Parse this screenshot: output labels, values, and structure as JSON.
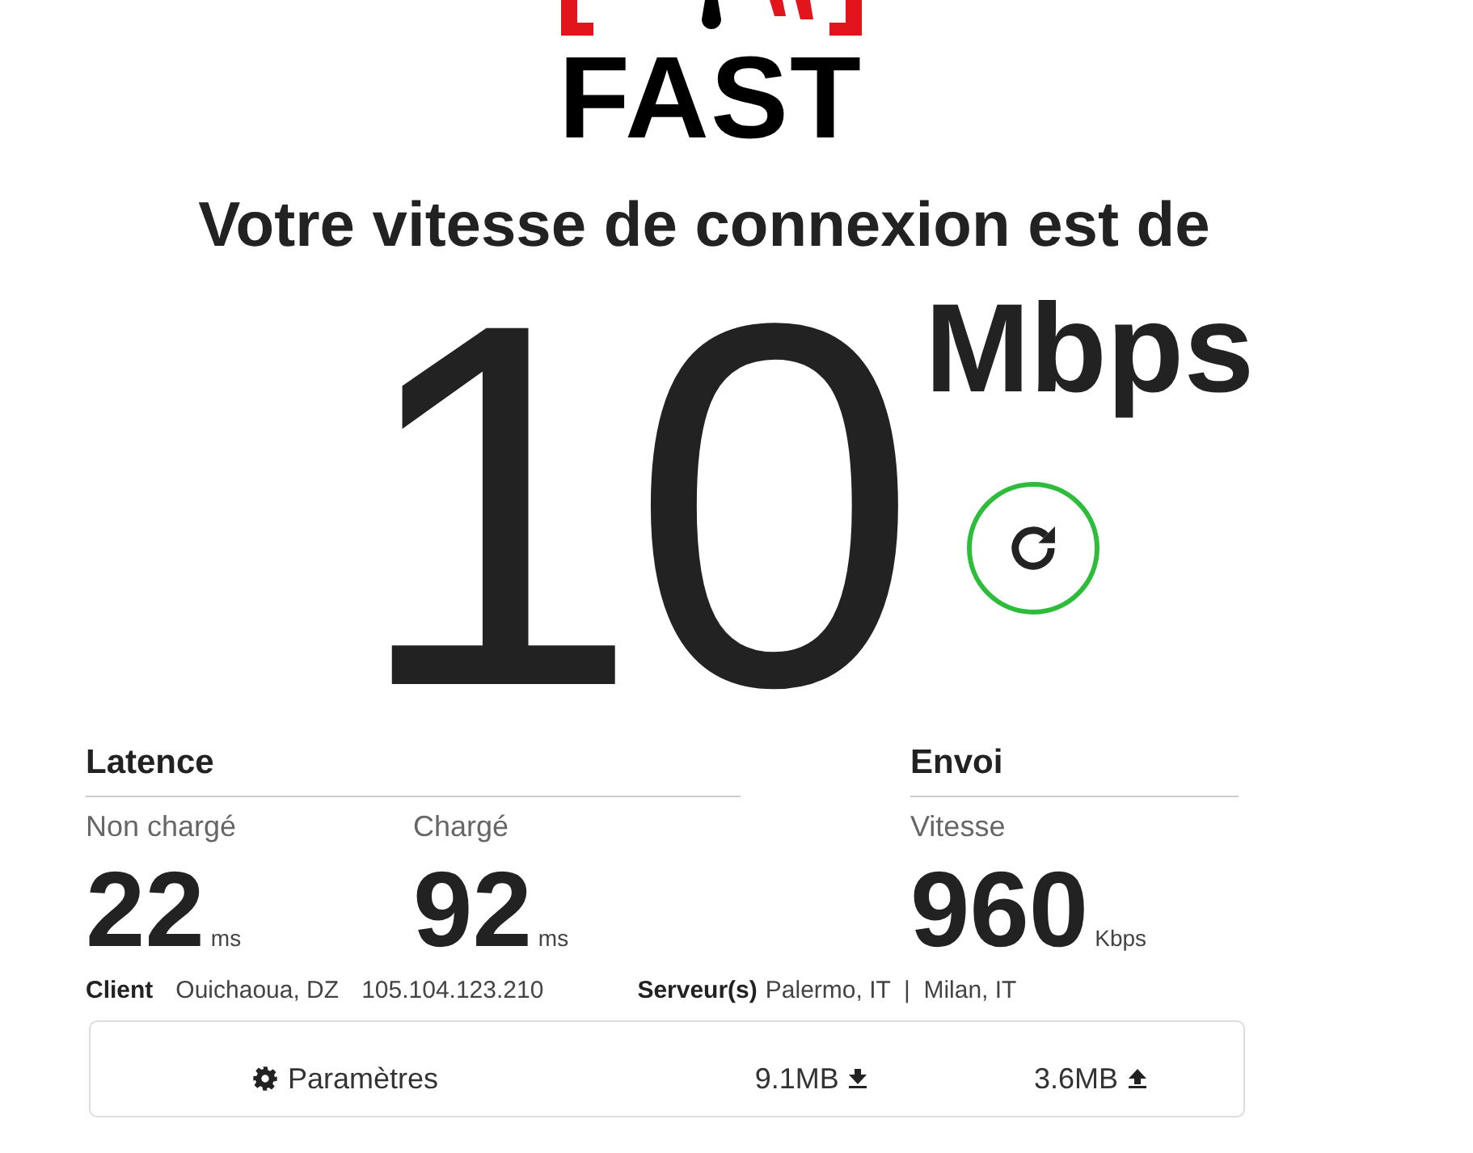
{
  "logo": {
    "text": "FAST"
  },
  "heading": "Votre vitesse de connexion est de",
  "speed": {
    "value": "10",
    "unit": "Mbps"
  },
  "latency": {
    "title": "Latence",
    "items": [
      {
        "label": "Non chargé",
        "value": "22",
        "unit": "ms"
      },
      {
        "label": "Chargé",
        "value": "92",
        "unit": "ms"
      }
    ]
  },
  "upload": {
    "title": "Envoi",
    "items": [
      {
        "label": "Vitesse",
        "value": "960",
        "unit": "Kbps"
      }
    ]
  },
  "client": {
    "label": "Client",
    "location": "Ouichaoua, DZ",
    "ip": "105.104.123.210"
  },
  "servers": {
    "label": "Serveur(s)",
    "list": "Palermo, IT  |  Milan, IT"
  },
  "footer": {
    "settings": "Paramètres",
    "download": "9.1MB",
    "upload": "3.6MB"
  }
}
